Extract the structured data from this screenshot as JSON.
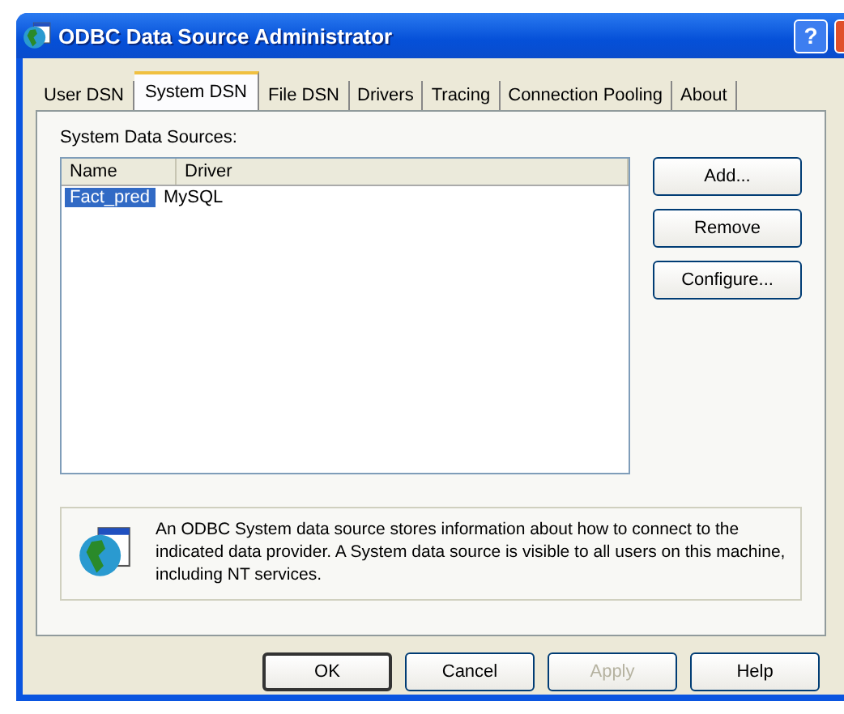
{
  "window": {
    "title": "ODBC Data Source Administrator",
    "help_button": "?"
  },
  "tabs": [
    {
      "label": "User DSN",
      "selected": false
    },
    {
      "label": "System DSN",
      "selected": true
    },
    {
      "label": "File DSN",
      "selected": false
    },
    {
      "label": "Drivers",
      "selected": false
    },
    {
      "label": "Tracing",
      "selected": false
    },
    {
      "label": "Connection Pooling",
      "selected": false
    },
    {
      "label": "About",
      "selected": false
    }
  ],
  "list": {
    "label": "System Data Sources:",
    "columns": [
      "Name",
      "Driver"
    ],
    "rows": [
      {
        "cells": [
          "Fact_pred",
          "MySQL"
        ],
        "selected": true
      }
    ]
  },
  "side_buttons": [
    {
      "label": "Add..."
    },
    {
      "label": "Remove"
    },
    {
      "label": "Configure..."
    }
  ],
  "info": "An ODBC System data source stores information about how to connect to the indicated data provider.   A System data source is visible to all users on this machine, including NT services.",
  "buttons": [
    {
      "label": "OK",
      "disabled": false,
      "default": true
    },
    {
      "label": "Cancel",
      "disabled": false,
      "default": false
    },
    {
      "label": "Apply",
      "disabled": true,
      "default": false
    },
    {
      "label": "Help",
      "disabled": false,
      "default": false
    }
  ]
}
